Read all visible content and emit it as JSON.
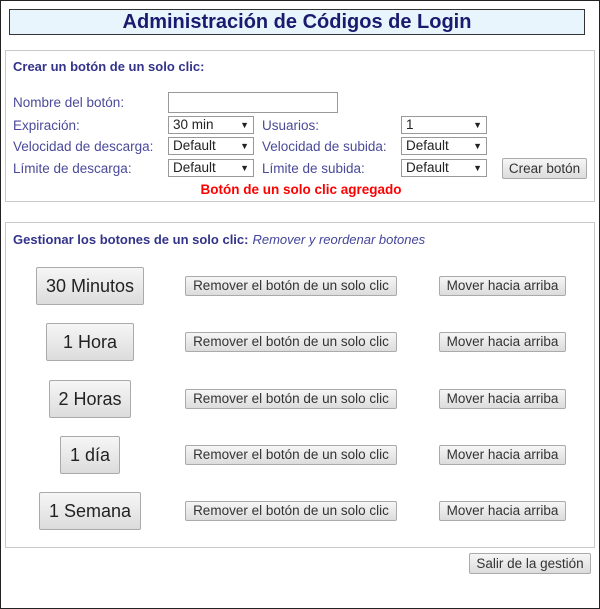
{
  "title": "Administración de Códigos de Login",
  "create": {
    "heading": "Crear un botón de un solo clic:",
    "name_label": "Nombre del botón:",
    "name_value": "",
    "expiration_label": "Expiración:",
    "expiration_value": "30 min",
    "users_label": "Usuarios:",
    "users_value": "1",
    "download_speed_label": "Velocidad de descarga:",
    "download_speed_value": "Default",
    "upload_speed_label": "Velocidad de subida:",
    "upload_speed_value": "Default",
    "download_limit_label": "Límite de descarga:",
    "download_limit_value": "Default",
    "upload_limit_label": "Límite de subida:",
    "upload_limit_value": "Default",
    "create_button": "Crear botón",
    "status_message": "Botón de un solo clic agregado"
  },
  "manage": {
    "heading": "Gestionar los botones de un solo clic:",
    "subheading": "Remover y reordenar botones",
    "rows": [
      {
        "label": "30 Minutos",
        "remove": "Remover el botón de un solo clic",
        "move": "Mover hacia arriba"
      },
      {
        "label": "1 Hora",
        "remove": "Remover el botón de un solo clic",
        "move": "Mover hacia arriba"
      },
      {
        "label": "2 Horas",
        "remove": "Remover el botón de un solo clic",
        "move": "Mover hacia arriba"
      },
      {
        "label": "1 día",
        "remove": "Remover el botón de un solo clic",
        "move": "Mover hacia arriba"
      },
      {
        "label": "1 Semana",
        "remove": "Remover el botón de un solo clic",
        "move": "Mover hacia arriba"
      }
    ]
  },
  "exit_button": "Salir de la gestión"
}
